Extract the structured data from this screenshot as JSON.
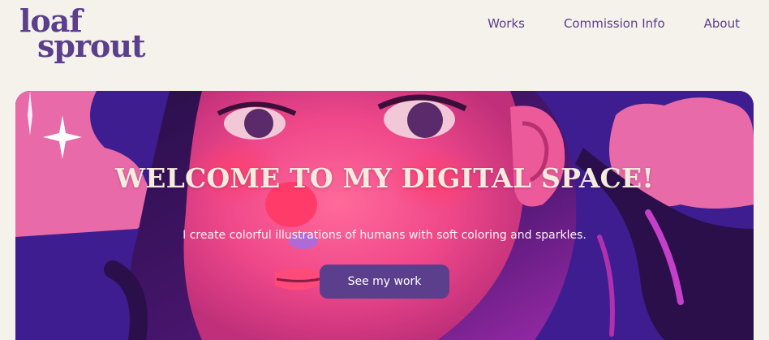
{
  "brand": {
    "line1": "loaf",
    "line2": "sprout"
  },
  "nav": {
    "items": [
      "Works",
      "Commission Info",
      "About"
    ]
  },
  "hero": {
    "title": "WELCOME TO MY DIGITAL SPACE!",
    "subtitle": "I create colorful illustrations of humans with soft coloring and sparkles.",
    "cta_label": "See my work",
    "illustration": "painted-portrait-illustration"
  },
  "colors": {
    "background": "#f4f2ea",
    "brand_purple": "#5b3f8c",
    "hero_pink": "#e86aa8",
    "hero_navy": "#3a1a8c"
  }
}
